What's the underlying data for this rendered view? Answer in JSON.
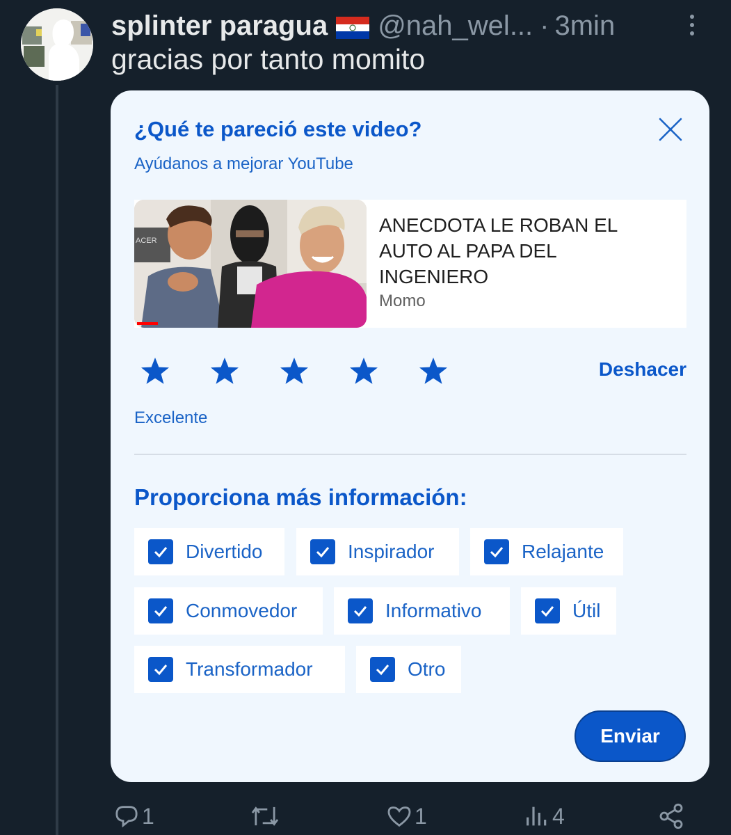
{
  "tweet": {
    "author_name": "splinter paragua",
    "handle": "@nah_wel...",
    "separator": "·",
    "time": "3min",
    "text": "gracias por tanto momito"
  },
  "card": {
    "title": "¿Qué te pareció este video?",
    "subtitle": "Ayúdanos a mejorar YouTube",
    "video_title": "ANECDOTA LE ROBAN EL AUTO AL PAPA DEL INGENIERO",
    "video_channel": "Momo",
    "thumbnail_text": "ACER",
    "rating": {
      "value": 5,
      "max": 5
    },
    "undo_label": "Deshacer",
    "rating_label": "Excelente",
    "more_info_heading": "Proporciona más información:",
    "options": [
      {
        "label": "Divertido",
        "checked": true
      },
      {
        "label": "Inspirador",
        "checked": true
      },
      {
        "label": "Relajante",
        "checked": true
      },
      {
        "label": "Conmovedor",
        "checked": true
      },
      {
        "label": "Informativo",
        "checked": true
      },
      {
        "label": "Útil",
        "checked": true
      },
      {
        "label": "Transformador",
        "checked": true
      },
      {
        "label": "Otro",
        "checked": true
      }
    ],
    "send_label": "Enviar"
  },
  "actions": {
    "replies": "1",
    "likes": "1",
    "views": "4"
  },
  "colors": {
    "background": "#15202b",
    "card_bg": "#f0f7fe",
    "accent": "#0b57c9"
  }
}
